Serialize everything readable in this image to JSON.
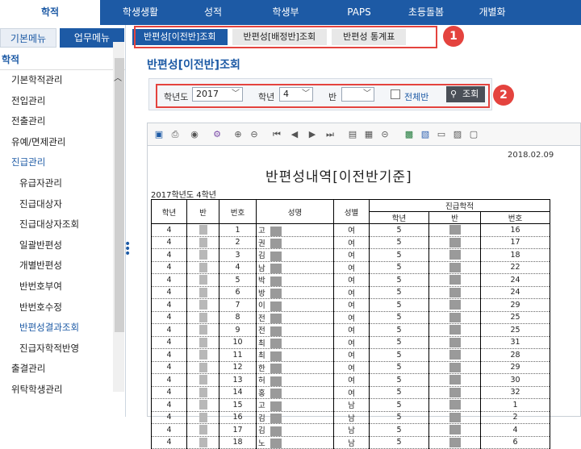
{
  "topnav": {
    "tabs": [
      "학적",
      "학생생활",
      "성적",
      "학생부",
      "PAPS",
      "초등돌봄",
      "개별화"
    ],
    "active": 0
  },
  "sidebar": {
    "menu_tabs": [
      "기본메뉴",
      "업무메뉴"
    ],
    "header": "학적",
    "items": [
      {
        "label": "기본학적관리",
        "level": 1,
        "highlight": false
      },
      {
        "label": "전입관리",
        "level": 1,
        "highlight": false
      },
      {
        "label": "전출관리",
        "level": 1,
        "highlight": false
      },
      {
        "label": "유예/면제관리",
        "level": 1,
        "highlight": false
      },
      {
        "label": "진급관리",
        "level": 1,
        "highlight": true
      },
      {
        "label": "유급자관리",
        "level": 2,
        "highlight": false
      },
      {
        "label": "진급대상자",
        "level": 2,
        "highlight": false
      },
      {
        "label": "진급대상자조회",
        "level": 2,
        "highlight": false
      },
      {
        "label": "일괄반편성",
        "level": 2,
        "highlight": false
      },
      {
        "label": "개별반편성",
        "level": 2,
        "highlight": false
      },
      {
        "label": "반번호부여",
        "level": 2,
        "highlight": false
      },
      {
        "label": "반번호수정",
        "level": 2,
        "highlight": false
      },
      {
        "label": "반편성결과조회",
        "level": 2,
        "highlight": true
      },
      {
        "label": "진급자학적반영",
        "level": 2,
        "highlight": false
      },
      {
        "label": "출결관리",
        "level": 1,
        "highlight": false
      },
      {
        "label": "위탁학생관리",
        "level": 1,
        "highlight": false
      }
    ]
  },
  "subtabs": [
    "반편성[이전반]조회",
    "반편성[배정반]조회",
    "반편성 통계표"
  ],
  "badges": [
    "1",
    "2"
  ],
  "page_title": "반편성[이전반]조회",
  "filter": {
    "year_label": "학년도",
    "year_value": "2017",
    "grade_label": "학년",
    "grade_value": "4",
    "class_label": "반",
    "class_value": "",
    "all_class_label": "전체반",
    "search_label": "조회"
  },
  "report": {
    "date": "2018.02.09",
    "title": "반편성내역[이전반기준]",
    "subtitle": "2017학년도  4학년",
    "headers": {
      "grade": "학년",
      "class": "반",
      "number": "번호",
      "name": "성명",
      "gender": "성별",
      "promo": "진급학적",
      "p_grade": "학년",
      "p_class": "반",
      "p_number": "번호"
    },
    "rows": [
      {
        "grade": "4",
        "number": "1",
        "name": "고",
        "gender": "여",
        "p_grade": "5",
        "p_number": "16"
      },
      {
        "grade": "4",
        "number": "2",
        "name": "권",
        "gender": "여",
        "p_grade": "5",
        "p_number": "17"
      },
      {
        "grade": "4",
        "number": "3",
        "name": "김",
        "gender": "여",
        "p_grade": "5",
        "p_number": "18"
      },
      {
        "grade": "4",
        "number": "4",
        "name": "남",
        "gender": "여",
        "p_grade": "5",
        "p_number": "22"
      },
      {
        "grade": "4",
        "number": "5",
        "name": "박",
        "gender": "여",
        "p_grade": "5",
        "p_number": "24"
      },
      {
        "grade": "4",
        "number": "6",
        "name": "방",
        "gender": "여",
        "p_grade": "5",
        "p_number": "24"
      },
      {
        "grade": "4",
        "number": "7",
        "name": "이",
        "gender": "여",
        "p_grade": "5",
        "p_number": "29"
      },
      {
        "grade": "4",
        "number": "8",
        "name": "전",
        "gender": "여",
        "p_grade": "5",
        "p_number": "25"
      },
      {
        "grade": "4",
        "number": "9",
        "name": "전",
        "gender": "여",
        "p_grade": "5",
        "p_number": "25"
      },
      {
        "grade": "4",
        "number": "10",
        "name": "최",
        "gender": "여",
        "p_grade": "5",
        "p_number": "31"
      },
      {
        "grade": "4",
        "number": "11",
        "name": "최",
        "gender": "여",
        "p_grade": "5",
        "p_number": "28"
      },
      {
        "grade": "4",
        "number": "12",
        "name": "한",
        "gender": "여",
        "p_grade": "5",
        "p_number": "29"
      },
      {
        "grade": "4",
        "number": "13",
        "name": "허",
        "gender": "여",
        "p_grade": "5",
        "p_number": "30"
      },
      {
        "grade": "4",
        "number": "14",
        "name": "홍",
        "gender": "여",
        "p_grade": "5",
        "p_number": "32"
      },
      {
        "grade": "4",
        "number": "15",
        "name": "고",
        "gender": "남",
        "p_grade": "5",
        "p_number": "1"
      },
      {
        "grade": "4",
        "number": "16",
        "name": "김",
        "gender": "남",
        "p_grade": "5",
        "p_number": "2"
      },
      {
        "grade": "4",
        "number": "17",
        "name": "김",
        "gender": "남",
        "p_grade": "5",
        "p_number": "4"
      },
      {
        "grade": "4",
        "number": "18",
        "name": "노",
        "gender": "남",
        "p_grade": "5",
        "p_number": "6"
      }
    ]
  },
  "colors": {
    "brand": "#1d5aa5",
    "highlight": "#e4433e"
  }
}
